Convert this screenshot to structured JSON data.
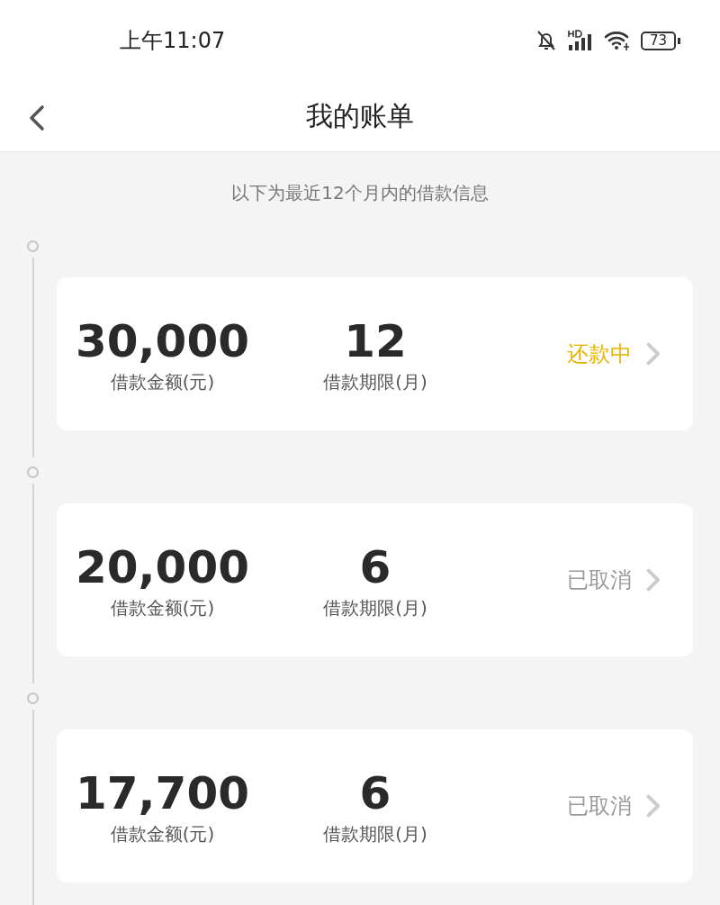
{
  "status_bar": {
    "time": "上午11:07",
    "battery": "73"
  },
  "nav": {
    "title": "我的账单"
  },
  "subtitle": "以下为最近12个月内的借款信息",
  "loans": [
    {
      "amount": "30,000",
      "amount_label": "借款金额(元)",
      "term": "12",
      "term_label": "借款期限(月)",
      "status": {
        "kind": "active",
        "text": "还款中"
      }
    },
    {
      "amount": "20,000",
      "amount_label": "借款金额(元)",
      "term": "6",
      "term_label": "借款期限(月)",
      "status": {
        "kind": "cancelled",
        "text": "已取消"
      }
    },
    {
      "amount": "17,700",
      "amount_label": "借款金额(元)",
      "term": "6",
      "term_label": "借款期限(月)",
      "status": {
        "kind": "cancelled",
        "text": "已取消"
      }
    }
  ]
}
